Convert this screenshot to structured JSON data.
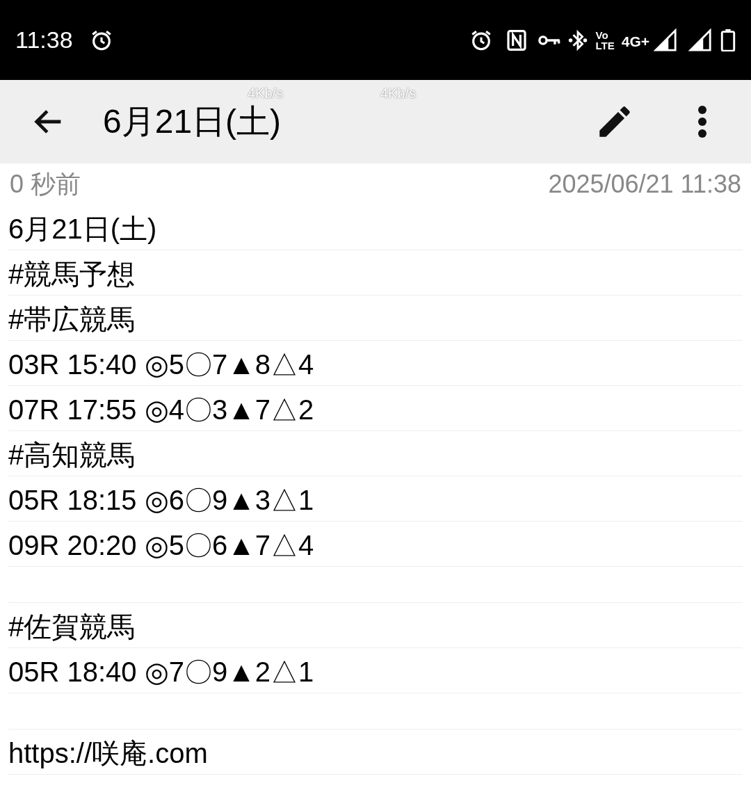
{
  "status_bar": {
    "time": "11:38",
    "volte_top": "Vo",
    "volte_bottom": "LTE",
    "network": "4G+"
  },
  "speed_overlays": [
    "4Kb/s",
    "4Kb/s"
  ],
  "app_bar": {
    "title": "6月21日(土)"
  },
  "meta": {
    "relative_time": "0 秒前",
    "timestamp": "2025/06/21 11:38"
  },
  "note_lines": [
    {
      "kind": "text",
      "text": "6月21日(土)"
    },
    {
      "kind": "text",
      "text": "#競馬予想"
    },
    {
      "kind": "text",
      "text": "#帯広競馬"
    },
    {
      "kind": "text",
      "text": "03R 15:40 ◎5〇7▲8△4"
    },
    {
      "kind": "text",
      "text": "07R 17:55 ◎4〇3▲7△2"
    },
    {
      "kind": "text",
      "text": "#高知競馬"
    },
    {
      "kind": "text",
      "text": "05R 18:15 ◎6〇9▲3△1"
    },
    {
      "kind": "text",
      "text": "09R 20:20 ◎5〇6▲7△4"
    },
    {
      "kind": "blank"
    },
    {
      "kind": "text",
      "text": "#佐賀競馬"
    },
    {
      "kind": "text",
      "text": "05R 18:40 ◎7〇9▲2△1"
    },
    {
      "kind": "blank"
    },
    {
      "kind": "text",
      "text": "https://咲庵.com"
    }
  ]
}
